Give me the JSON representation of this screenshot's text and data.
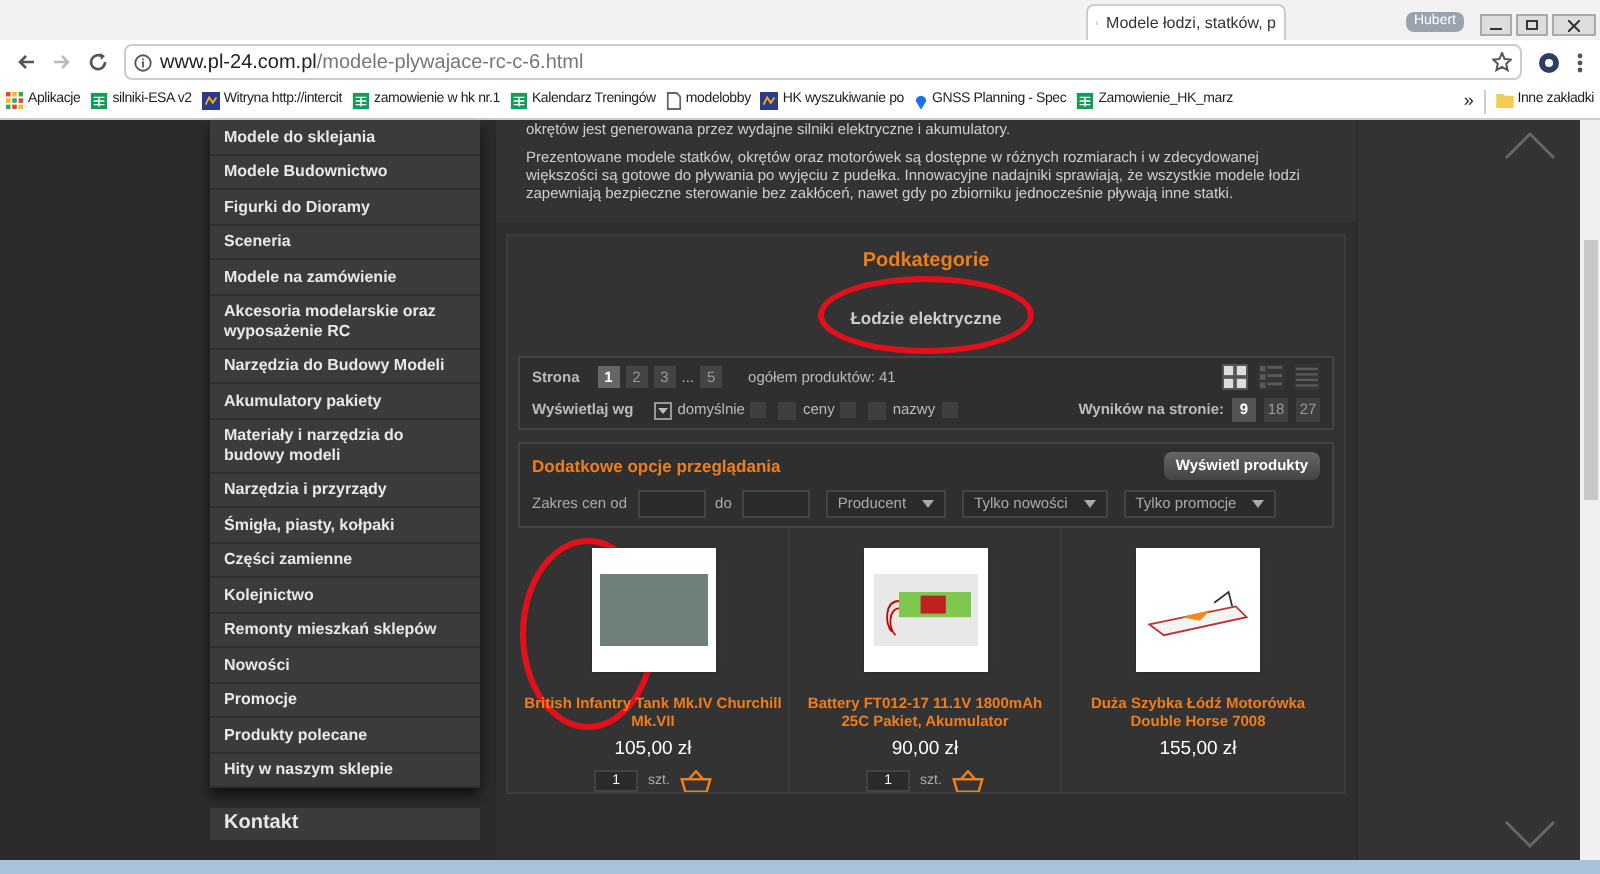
{
  "browser": {
    "tab_title": "Modele łodzi, statków, p",
    "user": "Hubert",
    "url_host": "www.pl-24.com.pl",
    "url_path": "/modele-plywajace-rc-c-6.html",
    "bookmarks": [
      {
        "label": "Aplikacje",
        "kind": "apps"
      },
      {
        "label": "silniki-ESA v2",
        "kind": "sheet"
      },
      {
        "label": "Witryna http://intercit",
        "kind": "site"
      },
      {
        "label": "zamowienie w hk nr.1",
        "kind": "sheet"
      },
      {
        "label": "Kalendarz Treningów",
        "kind": "sheet"
      },
      {
        "label": "modelobby",
        "kind": "page"
      },
      {
        "label": "HK wyszukiwanie po",
        "kind": "site"
      },
      {
        "label": "GNSS Planning - Spec",
        "kind": "pin"
      },
      {
        "label": "Zamowienie_HK_marz",
        "kind": "sheet"
      }
    ],
    "more": "»",
    "other_bookmarks": "Inne zakładki"
  },
  "sidebar": {
    "items": [
      {
        "label": "Modele do sklejania"
      },
      {
        "label": "Modele Budownictwo"
      },
      {
        "label": "Figurki do Dioramy"
      },
      {
        "label": "Sceneria"
      },
      {
        "label": "Modele na zamówienie"
      },
      {
        "label": "Akcesoria modelarskie oraz wyposażenie RC"
      },
      {
        "label": "Narzędzia do Budowy Modeli"
      },
      {
        "label": "Akumulatory pakiety"
      },
      {
        "label": "Materiały i narzędzia do budowy modeli"
      },
      {
        "label": "Narzędzia i przyrządy"
      },
      {
        "label": "Śmigła, piasty, kołpaki"
      },
      {
        "label": "Części zamienne"
      },
      {
        "label": "Kolejnictwo"
      },
      {
        "label": "Remonty mieszkań sklepów"
      },
      {
        "label": "Nowości"
      },
      {
        "label": "Promocje"
      },
      {
        "label": "Produkty polecane"
      },
      {
        "label": "Hity w naszym sklepie"
      }
    ],
    "footer": "Kontakt"
  },
  "description": [
    "okrętów jest generowana przez wydajne silniki elektryczne i akumulatory.",
    "Prezentowane modele statków, okrętów oraz motorówek są dostępne w różnych rozmiarach i w zdecydowanej większości są gotowe do pływania po wyjęciu z pudełka. Innowacyjne nadajniki sprawiają, że wszystkie modele łodzi zapewniają bezpieczne sterowanie bez zakłóceń, nawet gdy po zbiorniku jednocześnie pływają inne statki."
  ],
  "subcategories": {
    "title": "Podkategorie",
    "items": [
      {
        "label": "Łodzie elektryczne",
        "circled": true
      }
    ]
  },
  "paging": {
    "label": "Strona",
    "pages": [
      {
        "label": "1",
        "selected": true
      },
      {
        "label": "2",
        "selected": false
      },
      {
        "label": "3",
        "selected": false
      },
      {
        "label": "...",
        "kind": "gap"
      },
      {
        "label": "5",
        "selected": false
      }
    ],
    "total": "ogółem produktów: 41",
    "views": [
      {
        "kind": "grid",
        "selected": true
      },
      {
        "kind": "list",
        "selected": false
      },
      {
        "kind": "lines",
        "selected": false
      }
    ]
  },
  "sorting": {
    "label": "Wyświetlaj wg",
    "options": [
      {
        "label": "domyślnie",
        "selected": true
      },
      {
        "label": "ceny",
        "selected": false
      },
      {
        "label": "nazwy",
        "selected": false
      }
    ]
  },
  "per_page": {
    "label": "Wyników na stronie:",
    "options": [
      {
        "label": "9",
        "selected": true
      },
      {
        "label": "18",
        "selected": false
      },
      {
        "label": "27",
        "selected": false
      }
    ]
  },
  "filters": {
    "title": "Dodatkowe opcje przeglądania",
    "button": "Wyświetl produkty",
    "price_label": "Zakres cen od",
    "to_label": "do",
    "selects": [
      "Producent",
      "Tylko nowości",
      "Tylko promocje"
    ]
  },
  "products": [
    {
      "name": "British Infantry Tank Mk.IV Churchill Mk.VII",
      "price": "105,00 zł",
      "qty": "1",
      "unit": "szt.",
      "kind": "tank",
      "circled": true
    },
    {
      "name": "Battery FT012-17 11.1V 1800mAh 25C Pakiet, Akumulator",
      "price": "90,00 zł",
      "qty": "1",
      "unit": "szt.",
      "kind": "battery"
    },
    {
      "name": "Duża Szybka Łódź Motorówka Double Horse 7008",
      "price": "155,00 zł",
      "kind": "boat"
    }
  ]
}
